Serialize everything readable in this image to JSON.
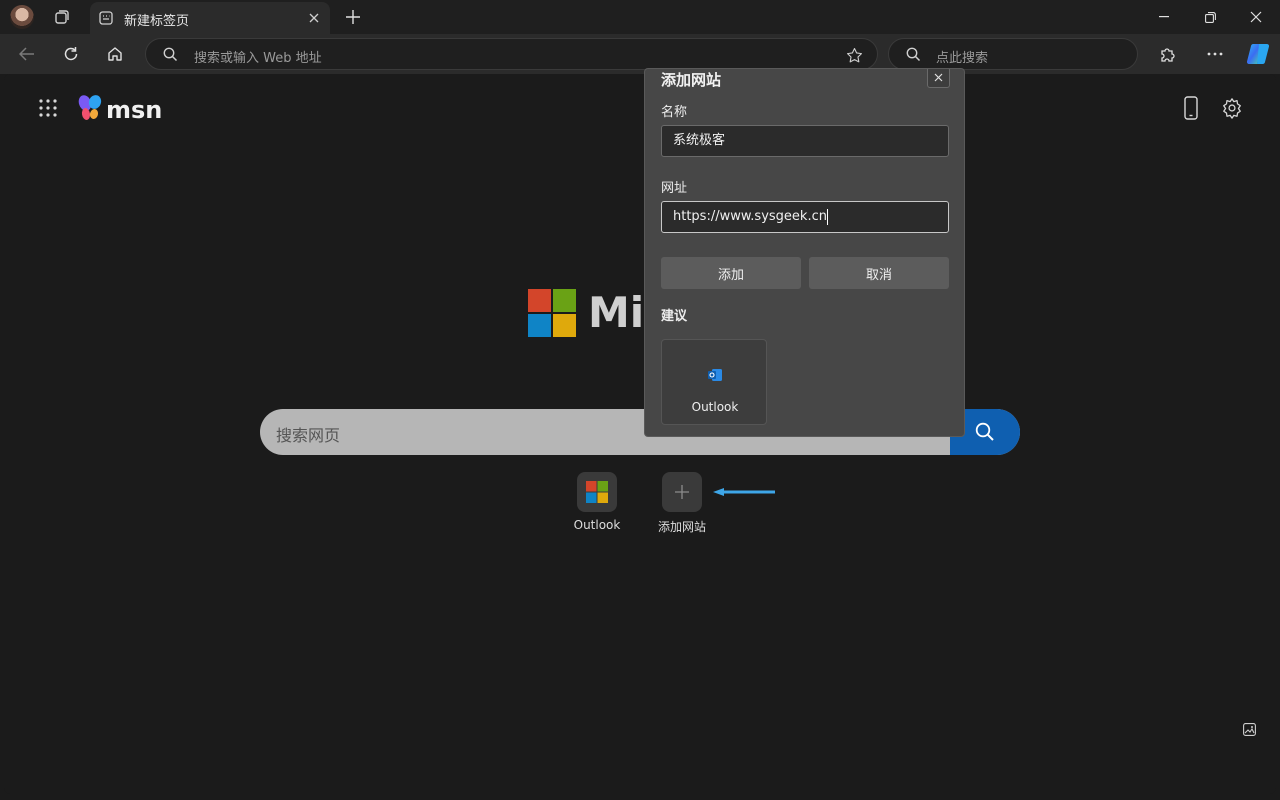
{
  "browser": {
    "tab_title": "新建标签页",
    "address_placeholder": "搜索或输入 Web 地址",
    "search_placeholder": "点此搜索"
  },
  "page": {
    "brand": "msn",
    "logo_text": "Microsoft",
    "search_placeholder": "搜索网页",
    "quick_links": [
      {
        "label": "Outlook"
      },
      {
        "label": "添加网站"
      }
    ]
  },
  "dialog": {
    "title": "添加网站",
    "name_label": "名称",
    "name_value": "系统极客",
    "url_label": "网址",
    "url_value": "https://www.sysgeek.cn",
    "add_button": "添加",
    "cancel_button": "取消",
    "suggestions_label": "建议",
    "suggestion_item": "Outlook"
  },
  "colors": {
    "accent": "#0f5fb0",
    "arrow": "#3ea6e8"
  }
}
